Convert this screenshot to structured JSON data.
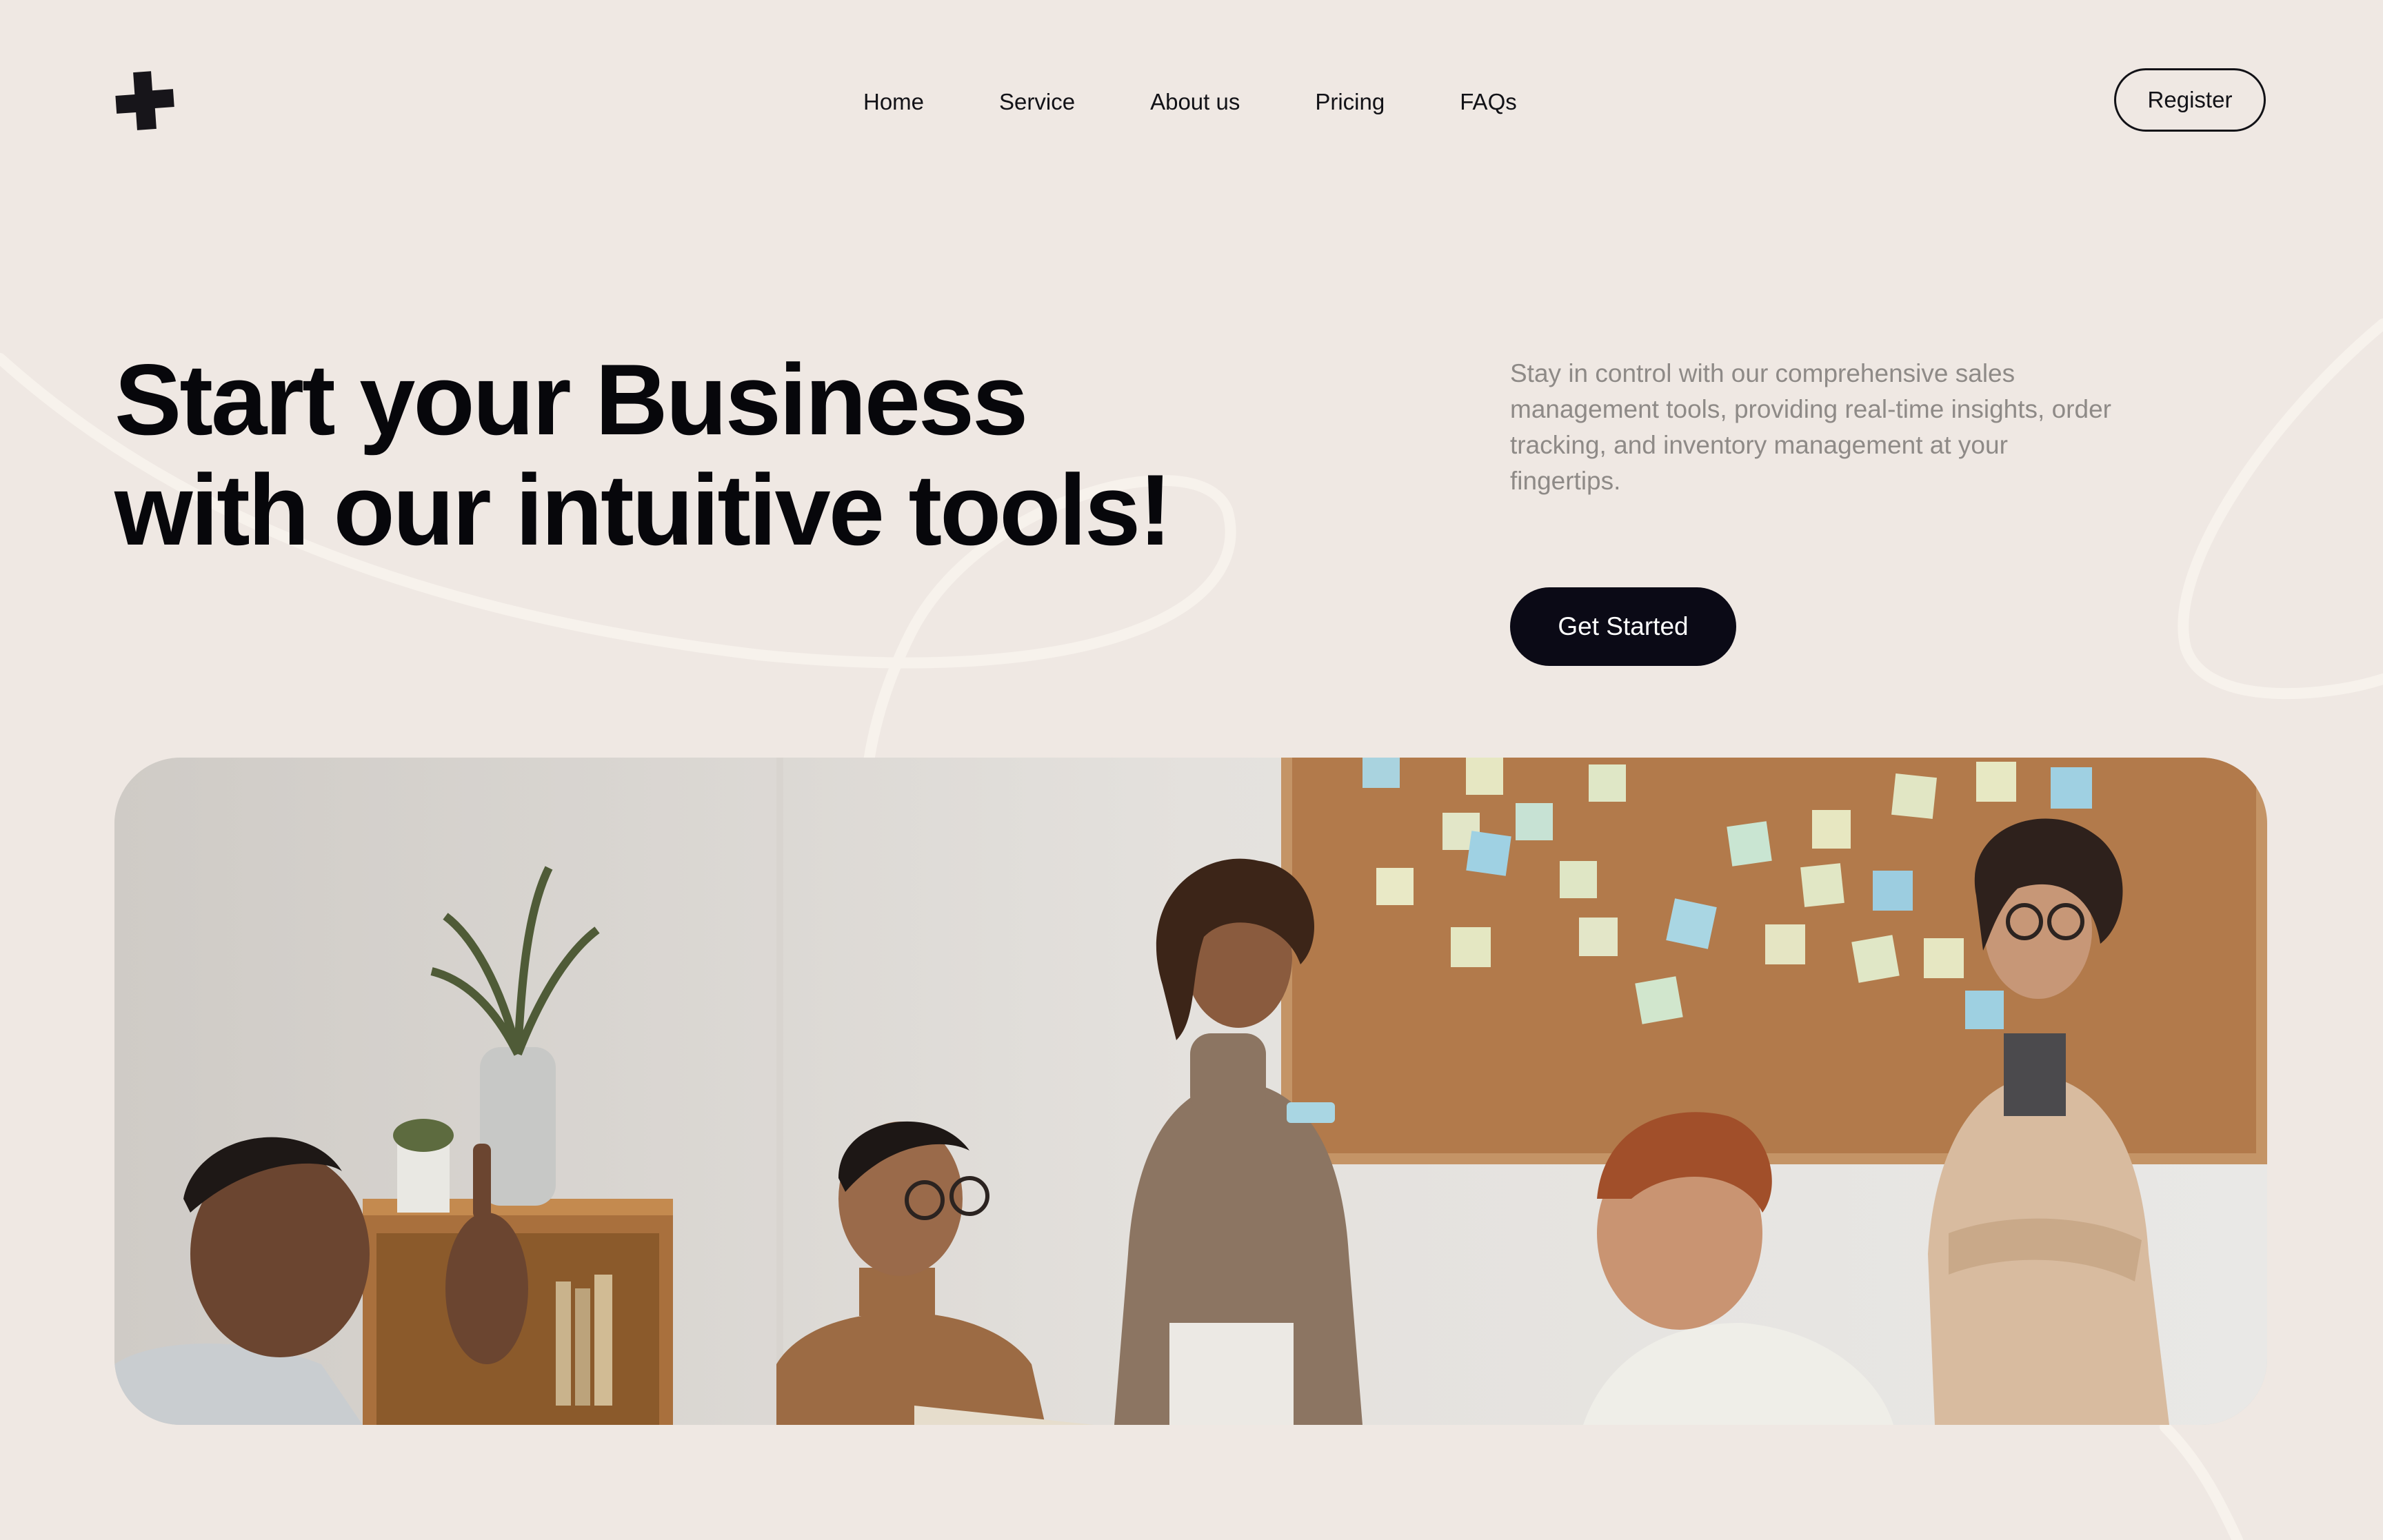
{
  "header": {
    "logo": "plus-shape-logo",
    "nav": [
      {
        "label": "Home"
      },
      {
        "label": "Service"
      },
      {
        "label": "About us"
      },
      {
        "label": "Pricing"
      },
      {
        "label": "FAQs"
      }
    ],
    "register_label": "Register"
  },
  "hero": {
    "headline_line1": "Start your Business",
    "headline_line2": "with our intuitive tools!",
    "description": "Stay in control with our comprehensive sales management tools, providing real-time insights, order tracking, and inventory management at your fingertips.",
    "cta_label": "Get Started"
  },
  "photo": {
    "subject": "team-meeting-photo"
  },
  "colors": {
    "background": "#efe8e3",
    "text": "#0a0a0f",
    "muted_text": "#8e8a87",
    "cta_background": "#0b0a16",
    "swirl": "#f7f3ee",
    "corkboard": "#b27a4b"
  }
}
